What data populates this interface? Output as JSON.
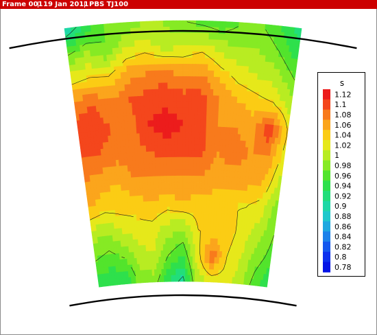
{
  "header": {
    "frame": "Frame 001",
    "date": "19 Jan 2011",
    "case": "PBS TJ100"
  },
  "colors": {
    "header_bg": "#cc0000",
    "header_text": "#ffffff"
  },
  "chart_data": {
    "type": "heatmap",
    "title": "",
    "variable": "s",
    "geometry": "annular sector (blade-passage cross section)",
    "colorbar": {
      "levels": [
        1.12,
        1.1,
        1.08,
        1.06,
        1.04,
        1.02,
        1,
        0.98,
        0.96,
        0.94,
        0.92,
        0.9,
        0.88,
        0.86,
        0.84,
        0.82,
        0.8,
        0.78
      ],
      "colors": [
        "#ec1c1c",
        "#f4461c",
        "#f87a1c",
        "#fba51c",
        "#fbcc14",
        "#e6e81a",
        "#b8ec22",
        "#86ea24",
        "#52e42c",
        "#2ee04c",
        "#22de7a",
        "#1ed8a6",
        "#1ec8cc",
        "#1ea8e0",
        "#1c82ea",
        "#1458ee",
        "#0c30ee",
        "#0414e6"
      ]
    },
    "value_range": [
      0.78,
      1.12
    ],
    "contour_lines": true,
    "legend_position": "right",
    "field_rows_tip_to_hub": [
      [
        0.88,
        0.93,
        0.97,
        0.97,
        0.99,
        0.99,
        0.97,
        0.96,
        0.95,
        0.97,
        0.97,
        0.95,
        0.92
      ],
      [
        0.97,
        0.99,
        0.97,
        1.01,
        1.02,
        1.0,
        1.01,
        1.02,
        1.0,
        0.99,
        0.99,
        0.97,
        0.94
      ],
      [
        1.02,
        1.03,
        1.03,
        1.06,
        1.07,
        1.08,
        1.06,
        1.07,
        1.04,
        1.02,
        1.01,
        1.0,
        0.97
      ],
      [
        1.08,
        1.09,
        1.07,
        1.09,
        1.1,
        1.105,
        1.1,
        1.1,
        1.07,
        1.05,
        1.04,
        1.03,
        1.0
      ],
      [
        1.1,
        1.1,
        1.09,
        1.08,
        1.11,
        1.12,
        1.11,
        1.1,
        1.07,
        1.07,
        1.06,
        1.11,
        1.03
      ],
      [
        1.09,
        1.09,
        1.08,
        1.08,
        1.09,
        1.1,
        1.1,
        1.1,
        1.07,
        1.08,
        1.07,
        1.07,
        1.02
      ],
      [
        1.07,
        1.06,
        1.05,
        1.07,
        1.07,
        1.07,
        1.07,
        1.07,
        1.06,
        1.06,
        1.06,
        1.05,
        1.0
      ],
      [
        1.05,
        1.04,
        1.04,
        1.04,
        1.05,
        1.04,
        1.05,
        1.04,
        1.04,
        1.03,
        1.03,
        1.02,
        0.98
      ],
      [
        1.0,
        0.99,
        1.01,
        1.02,
        1.02,
        1.0,
        0.99,
        1.03,
        1.03,
        1.04,
        1.02,
        1.0,
        0.97
      ],
      [
        0.97,
        0.96,
        0.97,
        1.0,
        1.01,
        0.97,
        0.95,
        1.02,
        1.09,
        1.03,
        1.01,
        0.98,
        0.96
      ],
      [
        0.94,
        0.93,
        0.93,
        0.98,
        0.98,
        0.93,
        0.9,
        1.0,
        1.01,
        1.02,
        1.0,
        0.96,
        0.93
      ]
    ]
  }
}
